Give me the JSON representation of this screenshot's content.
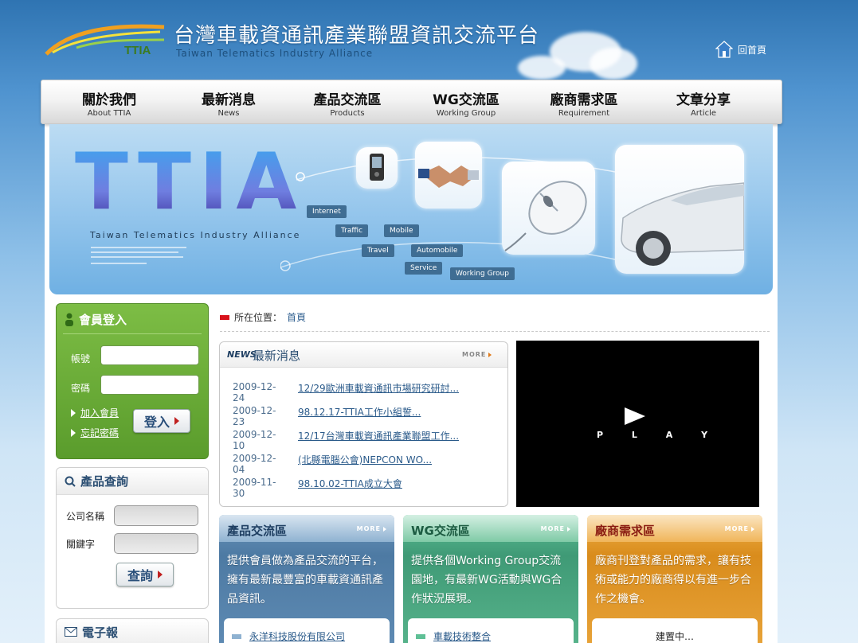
{
  "header": {
    "title": "台灣車載資通訊產業聯盟資訊交流平台",
    "subtitle": "Taiwan Telematics Industry Alliance",
    "logo_text": "TTIA",
    "home_label": "回首頁"
  },
  "nav": [
    {
      "zh": "關於我們",
      "en": "About TTIA"
    },
    {
      "zh": "最新消息",
      "en": "News"
    },
    {
      "zh": "產品交流區",
      "en": "Products"
    },
    {
      "zh": "WG交流區",
      "en": "Working Group"
    },
    {
      "zh": "廠商需求區",
      "en": "Requirement"
    },
    {
      "zh": "文章分享",
      "en": "Article"
    }
  ],
  "banner": {
    "big_text": "TTIA",
    "tagline": "Taiwan Telematics Industry Alliance",
    "tags": [
      "Internet",
      "Traffic",
      "Mobile",
      "Travel",
      "Automobile",
      "Service",
      "Working Group"
    ]
  },
  "login": {
    "title": "會員登入",
    "account_label": "帳號",
    "password_label": "密碼",
    "join_label": "加入會員",
    "forgot_label": "忘記密碼",
    "submit_label": "登入"
  },
  "product_search": {
    "title": "產品查詢",
    "company_label": "公司名稱",
    "keyword_label": "關鍵字",
    "submit_label": "查詢"
  },
  "newsletter": {
    "title": "電子報"
  },
  "breadcrumb": {
    "prefix": "所在位置：",
    "current": "首頁"
  },
  "news": {
    "tag": "NEWS",
    "title": "最新消息",
    "more": "MORE",
    "items": [
      {
        "date": "2009-12-24",
        "title": "12/29歐洲車載資通訊市場研究研討..."
      },
      {
        "date": "2009-12-23",
        "title": "98.12.17-TTIA工作小組誓..."
      },
      {
        "date": "2009-12-10",
        "title": "12/17台灣車載資通訊產業聯盟工作..."
      },
      {
        "date": "2009-12-04",
        "title": "(北縣電腦公會)NEPCON WO..."
      },
      {
        "date": "2009-11-30",
        "title": "98.10.02-TTIA成立大會"
      }
    ]
  },
  "video": {
    "label": "P L A Y"
  },
  "cards": [
    {
      "title": "產品交流區",
      "more": "MORE",
      "text": "提供會員做為產品交流的平台，擁有最新最豐富的車載資通訊產品資訊。",
      "item": "永洋科技股份有限公司",
      "color": "#4d7aa3"
    },
    {
      "title": "WG交流區",
      "more": "MORE",
      "text": "提供各個Working Group交流園地，有最新WG活動與WG合作狀況展現。",
      "item": "車載技術整合",
      "color": "#3f9a76"
    },
    {
      "title": "廠商需求區",
      "more": "MORE",
      "text": "廠商刊登對產品的需求，讓有技術或能力的廠商得以有進一步合作之機會。",
      "item": "建置中…",
      "color": "#d98c1c"
    }
  ]
}
